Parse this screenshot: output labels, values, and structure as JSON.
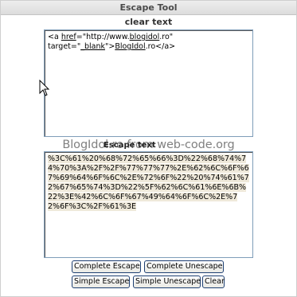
{
  "window": {
    "title": "Escape Tool"
  },
  "clear_section": {
    "label": "clear text",
    "line1_prefix": "<a ",
    "line1_href_word": "href",
    "line1_href_value": "=\"http://www.",
    "line1_domain": "blogidol",
    "line1_suffix": ".ro\"",
    "line2_prefix": "target=\"",
    "line2_blank": "_blank",
    "line2_mid": "\">",
    "line2_link": "BlogIdol",
    "line2_suffix": ".ro</a>"
  },
  "escape_section": {
    "label": "Escape text",
    "watermark": "BlogIdol.ro  from  web-code.org",
    "encoded": "%3C%61%20%68%72%65%66%3D%22%68%74%74%70%3A%2F%2F%77%77%77%2E%62%6C%6F%67%69%64%6F%6C%2E%72%6F%22%20%74%61%72%67%65%74%3D%22%5F%62%6C%61%6E%6B%22%3E%42%6C%6F%67%49%64%6F%6C%2E%72%6F%3C%2F%61%3E"
  },
  "buttons": {
    "complete_escape": "Complete Escape",
    "complete_unescape": "Complete Unescape",
    "simple_escape": "Simple Escape",
    "simple_unescape": "Simple Unescape",
    "clear": "Clear"
  },
  "icons": {
    "cursor": "mouse-pointer-icon"
  },
  "colors": {
    "title_bg": "#dcdcdc",
    "textarea_border": "#7f9db9",
    "button_border": "#1d3f72",
    "selection_bg": "#efe9da"
  }
}
